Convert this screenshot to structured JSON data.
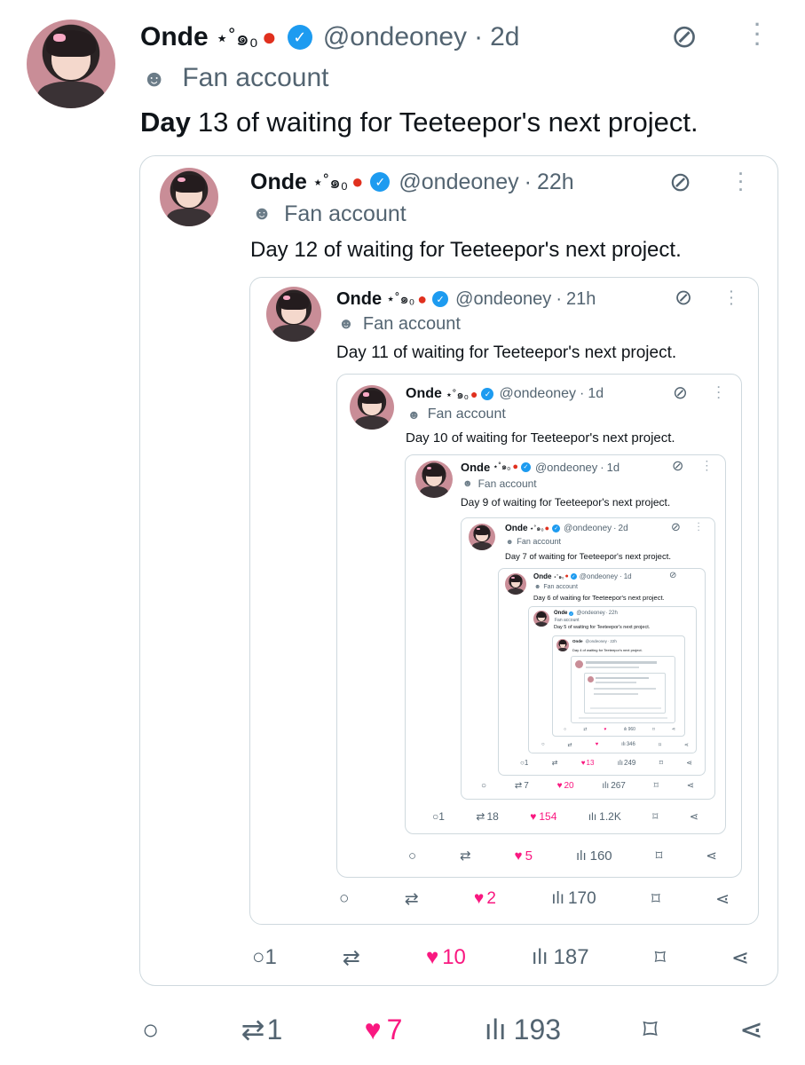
{
  "user": {
    "name": "Onde",
    "decor": "⋆˚๑₀",
    "handle": "@ondeoney",
    "label": "Fan account"
  },
  "tweets": [
    {
      "time": "2d",
      "text_bold": "Day",
      "text": "13 of waiting for Teeteepor's next project.",
      "replies": "",
      "retweets": "1",
      "likes": "7",
      "views": "193"
    },
    {
      "time": "22h",
      "text": "Day 12 of waiting for Teeteepor's next project.",
      "replies": "1",
      "retweets": "",
      "likes": "10",
      "views": "187"
    },
    {
      "time": "21h",
      "text": "Day 11 of waiting for Teeteepor's next project.",
      "replies": "",
      "retweets": "",
      "likes": "2",
      "views": "170"
    },
    {
      "time": "1d",
      "text": "Day 10 of waiting for Teeteepor's next project.",
      "replies": "",
      "retweets": "",
      "likes": "5",
      "views": "160"
    },
    {
      "time": "1d",
      "text": "Day 9 of waiting for Teeteepor's next project.",
      "replies": "1",
      "retweets": "18",
      "likes": "154",
      "views": "1.2K"
    },
    {
      "time": "2d",
      "text": "Day 7 of waiting for Teeteepor's next project.",
      "replies": "",
      "retweets": "7",
      "likes": "20",
      "views": "267"
    },
    {
      "time": "1d",
      "text": "Day 6 of waiting for Teeteepor's next project.",
      "replies": "1",
      "retweets": "",
      "likes": "13",
      "views": "249"
    },
    {
      "time": "22h",
      "text": "Day 5 of waiting for Teeteepor's next project.",
      "replies": "",
      "retweets": "",
      "likes": "",
      "views": "346"
    },
    {
      "time": "22h",
      "text": "Day 4 of waiting for Teeteepor's next project.",
      "replies": "",
      "retweets": "",
      "likes": "",
      "views": "960"
    }
  ],
  "colors": {
    "verified": "#1d9bf0",
    "heart": "#f91880",
    "muted": "#536471",
    "border": "#cfd9de"
  }
}
